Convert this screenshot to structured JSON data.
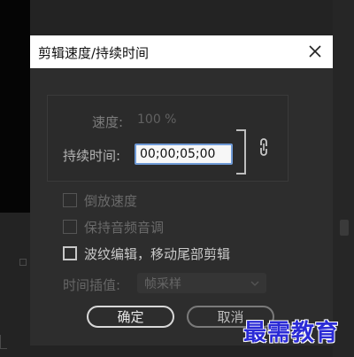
{
  "dialog": {
    "title": "剪辑速度/持续时间",
    "speed_label": "速度:",
    "speed_value": "100 %",
    "duration_label": "持续时间:",
    "duration_value": "00;00;05;00",
    "checkboxes": [
      {
        "label": "倒放速度",
        "checked": false,
        "enabled": false
      },
      {
        "label": "保持音频音调",
        "checked": false,
        "enabled": false
      },
      {
        "label": "波纹编辑，移动尾部剪辑",
        "checked": false,
        "enabled": true
      }
    ],
    "interp_label": "时间插值:",
    "interp_value": "帧采样",
    "ok_label": "确定",
    "cancel_label": "取消"
  },
  "watermark": "最需教育",
  "icons": {
    "close": "close-icon",
    "link": "link-icon",
    "dropdown": "chevron-down-icon"
  },
  "colors": {
    "dialog_bg": "#2d2d2d",
    "title_bg": "#ffffff",
    "input_focus": "#6f9ad6",
    "watermark": "#2b2bd6"
  }
}
